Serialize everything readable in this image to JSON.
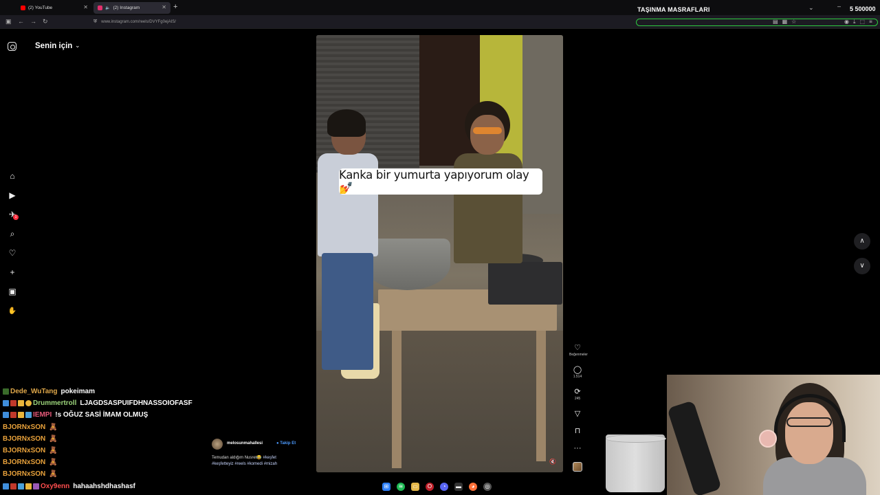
{
  "browser": {
    "tabs": [
      {
        "label": "(2) YouTube",
        "active": false,
        "favicon_color": "#ff0000"
      },
      {
        "label": "(2) Instagram",
        "active": true,
        "favicon_color": "#e1306c"
      }
    ],
    "url": "www.instagram.com/reels/DVYFg0ejAIS/"
  },
  "stream_goal": {
    "title": "TAŞINMA MASRAFLARI",
    "amount": "5 500000",
    "bar_color": "#2ecc40"
  },
  "instagram": {
    "feed_title": "Senin için",
    "nav_icons": [
      "home-icon",
      "reels-icon",
      "messages-icon",
      "search-icon",
      "heart-icon",
      "create-icon",
      "dashboard-icon",
      "profile-icon"
    ],
    "notification_count": "1",
    "reel": {
      "caption_overlay": "Kanka bir yumurta yapıyorum olay💅",
      "author": "melosunmahallesi",
      "follow_label": "Takip Et",
      "post_text": "Temudan aldığım Nusret😂",
      "hashtags_line1": "#keşfet",
      "hashtags_line2": "#keşfetteyiz #reels #komedi #mizah"
    },
    "actions": {
      "like_label": "Beğenmeler",
      "comments_count": "1.514",
      "reposts_count": "245",
      "more": "···"
    }
  },
  "chat": [
    {
      "user": "Dede_WuTang",
      "msg": "pokeimam",
      "color": "#e0a84a"
    },
    {
      "user": "Drummertroll",
      "msg": "LJAGDSASPUIFDHNASSOIOFASF",
      "color": "#9bd37a"
    },
    {
      "user": "IEMPI",
      "msg": "!s OĞUZ SASİ İMAM OLMUŞ",
      "color": "#e85a7a"
    },
    {
      "user": "BJORNxSON",
      "msg": "🧸",
      "color": "#e9a23b"
    },
    {
      "user": "BJORNxSON",
      "msg": "🧸",
      "color": "#e9a23b"
    },
    {
      "user": "BJORNxSON",
      "msg": "🧸",
      "color": "#e9a23b"
    },
    {
      "user": "BJORNxSON",
      "msg": "🧸",
      "color": "#e9a23b"
    },
    {
      "user": "BJORNxSON",
      "msg": "🧸",
      "color": "#e9a23b"
    },
    {
      "user": "Oxy9enn",
      "msg": "hahaahshdhashasf",
      "color": "#ff4d4d"
    }
  ]
}
